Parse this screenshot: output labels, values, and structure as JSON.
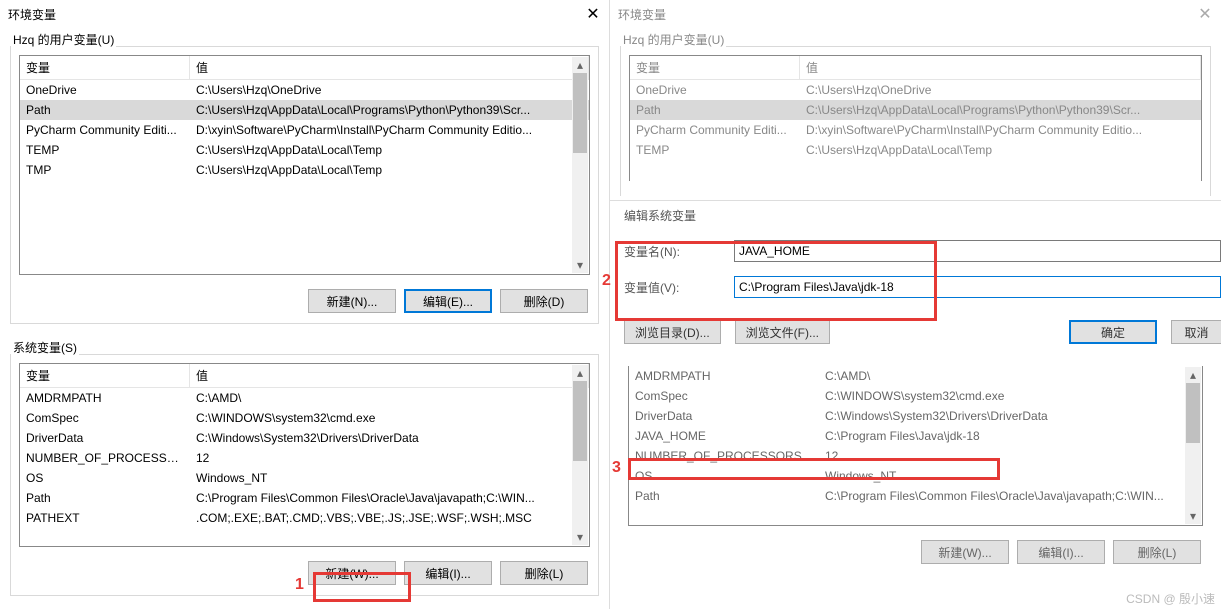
{
  "left": {
    "title": "环境变量",
    "user_vars": {
      "label": "Hzq 的用户变量(U)",
      "header_var": "变量",
      "header_val": "值",
      "rows": [
        {
          "var": "OneDrive",
          "val": "C:\\Users\\Hzq\\OneDrive"
        },
        {
          "var": "Path",
          "val": "C:\\Users\\Hzq\\AppData\\Local\\Programs\\Python\\Python39\\Scr...",
          "selected": true
        },
        {
          "var": "PyCharm Community Editi...",
          "val": "D:\\xyin\\Software\\PyCharm\\Install\\PyCharm Community Editio..."
        },
        {
          "var": "TEMP",
          "val": "C:\\Users\\Hzq\\AppData\\Local\\Temp"
        },
        {
          "var": "TMP",
          "val": "C:\\Users\\Hzq\\AppData\\Local\\Temp"
        }
      ],
      "btn_new": "新建(N)...",
      "btn_edit": "编辑(E)...",
      "btn_del": "删除(D)"
    },
    "sys_vars": {
      "label": "系统变量(S)",
      "header_var": "变量",
      "header_val": "值",
      "rows": [
        {
          "var": "AMDRMPATH",
          "val": "C:\\AMD\\"
        },
        {
          "var": "ComSpec",
          "val": "C:\\WINDOWS\\system32\\cmd.exe"
        },
        {
          "var": "DriverData",
          "val": "C:\\Windows\\System32\\Drivers\\DriverData"
        },
        {
          "var": "NUMBER_OF_PROCESSORS",
          "val": "12"
        },
        {
          "var": "OS",
          "val": "Windows_NT"
        },
        {
          "var": "Path",
          "val": "C:\\Program Files\\Common Files\\Oracle\\Java\\javapath;C:\\WIN..."
        },
        {
          "var": "PATHEXT",
          "val": ".COM;.EXE;.BAT;.CMD;.VBS;.VBE;.JS;.JSE;.WSF;.WSH;.MSC"
        }
      ],
      "btn_new": "新建(W)...",
      "btn_edit": "编辑(I)...",
      "btn_del": "删除(L)"
    }
  },
  "right": {
    "title": "环境变量",
    "user_vars": {
      "label": "Hzq 的用户变量(U)",
      "header_var": "变量",
      "header_val": "值",
      "rows": [
        {
          "var": "OneDrive",
          "val": "C:\\Users\\Hzq\\OneDrive"
        },
        {
          "var": "Path",
          "val": "C:\\Users\\Hzq\\AppData\\Local\\Programs\\Python\\Python39\\Scr...",
          "selected": true
        },
        {
          "var": "PyCharm Community Editi...",
          "val": "D:\\xyin\\Software\\PyCharm\\Install\\PyCharm Community Editio..."
        },
        {
          "var": "TEMP",
          "val": "C:\\Users\\Hzq\\AppData\\Local\\Temp"
        }
      ]
    },
    "edit": {
      "title": "编辑系统变量",
      "name_label": "变量名(N):",
      "name_value": "JAVA_HOME",
      "val_label": "变量值(V):",
      "val_value": "C:\\Program Files\\Java\\jdk-18",
      "btn_browse_dir": "浏览目录(D)...",
      "btn_browse_file": "浏览文件(F)...",
      "btn_ok": "确定",
      "btn_cancel": "取消"
    },
    "sys_vars": {
      "rows": [
        {
          "var": "AMDRMPATH",
          "val": "C:\\AMD\\"
        },
        {
          "var": "ComSpec",
          "val": "C:\\WINDOWS\\system32\\cmd.exe"
        },
        {
          "var": "DriverData",
          "val": "C:\\Windows\\System32\\Drivers\\DriverData"
        },
        {
          "var": "JAVA_HOME",
          "val": "C:\\Program Files\\Java\\jdk-18",
          "highlight": true
        },
        {
          "var": "NUMBER_OF_PROCESSORS",
          "val": "12"
        },
        {
          "var": "OS",
          "val": "Windows_NT"
        },
        {
          "var": "Path",
          "val": "C:\\Program Files\\Common Files\\Oracle\\Java\\javapath;C:\\WIN..."
        }
      ],
      "btn_new": "新建(W)...",
      "btn_edit": "编辑(I)...",
      "btn_del": "删除(L)"
    }
  },
  "annotations": {
    "num1": "1",
    "num2": "2",
    "num3": "3"
  },
  "watermark": "CSDN @ 殷小速"
}
